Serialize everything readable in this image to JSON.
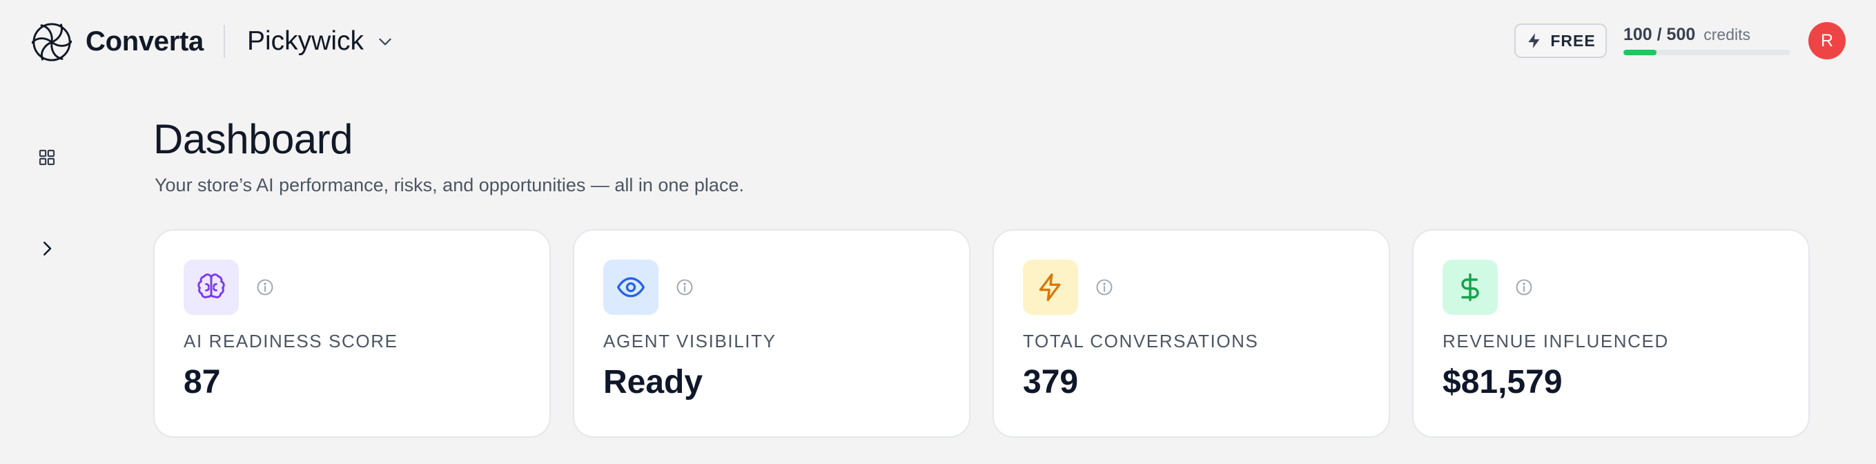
{
  "app": {
    "name": "Converta",
    "logo_icon": "spiral-logo-icon"
  },
  "store_switcher": {
    "name": "Pickywick",
    "icon": "chevron-down-icon"
  },
  "plan": {
    "label": "FREE",
    "icon": "lightning-icon"
  },
  "credits": {
    "used_text": "100 / 500",
    "unit_label": "credits",
    "used": 100,
    "total": 500,
    "fraction": 0.2,
    "bar_color": "#22c55e"
  },
  "user": {
    "avatar_initial": "R",
    "avatar_color": "#ef4444"
  },
  "sidebar": {
    "items": [
      {
        "icon": "grid-icon"
      },
      {
        "icon": "chevron-right-icon"
      }
    ]
  },
  "page": {
    "title": "Dashboard",
    "subtitle": "Your store’s AI performance, risks, and opportunities — all in one place."
  },
  "cards": [
    {
      "label": "AI READINESS SCORE",
      "value": "87",
      "icon": "brain-icon",
      "icon_bg": "#ede9fe",
      "icon_color": "#7c3aed"
    },
    {
      "label": "AGENT VISIBILITY",
      "value": "Ready",
      "icon": "eye-icon",
      "icon_bg": "#dbeafe",
      "icon_color": "#2563eb"
    },
    {
      "label": "TOTAL CONVERSATIONS",
      "value": "379",
      "icon": "lightning-icon",
      "icon_bg": "#fef3c7",
      "icon_color": "#d97706"
    },
    {
      "label": "REVENUE INFLUENCED",
      "value": "$81,579",
      "icon": "dollar-icon",
      "icon_bg": "#d1fae5",
      "icon_color": "#16a34a"
    }
  ]
}
